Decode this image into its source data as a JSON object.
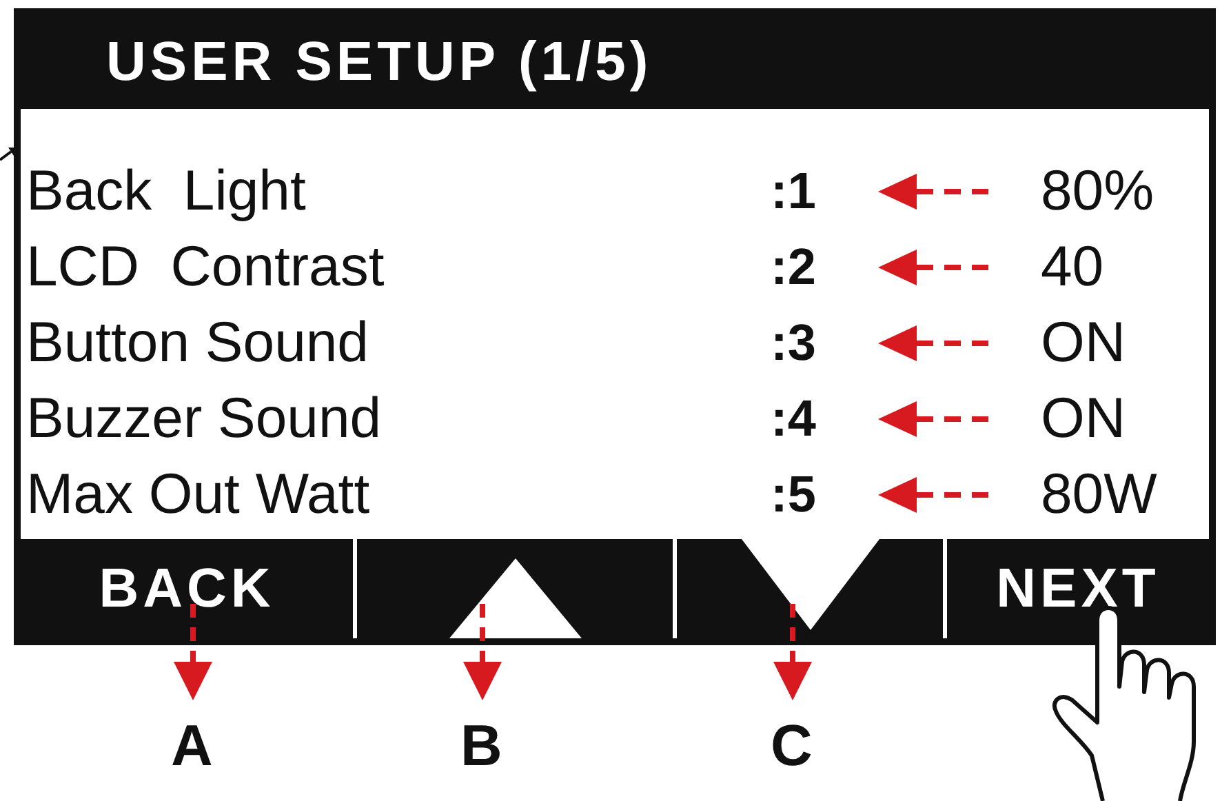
{
  "screen": {
    "title": "USER SETUP (1/5)",
    "settings": [
      {
        "label": "Back  Light",
        "index": ":1",
        "value": "80%"
      },
      {
        "label": "LCD  Contrast",
        "index": ":2",
        "value": "40"
      },
      {
        "label": "Button Sound",
        "index": ":3",
        "value": "ON"
      },
      {
        "label": "Buzzer Sound",
        "index": ":4",
        "value": "ON"
      },
      {
        "label": "Max Out Watt",
        "index": ":5",
        "value": "80W"
      }
    ],
    "buttons": [
      {
        "kind": "text",
        "label": "BACK"
      },
      {
        "kind": "up"
      },
      {
        "kind": "down"
      },
      {
        "kind": "text",
        "label": "NEXT"
      }
    ]
  },
  "callouts": [
    "A",
    "B",
    "C"
  ]
}
